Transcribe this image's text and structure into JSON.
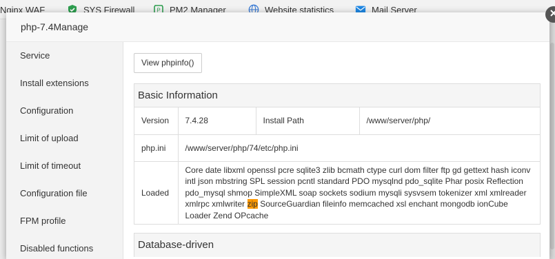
{
  "background_bar": {
    "items": [
      {
        "label": "Nginx WAF",
        "icon": "shield-icon"
      },
      {
        "label": "SYS Firewall",
        "icon": "shield-icon"
      },
      {
        "label": "PM2 Manager",
        "icon": "pm2-icon"
      },
      {
        "label": "Website statistics",
        "icon": "globe-icon"
      },
      {
        "label": "Mail Server",
        "icon": "mail-icon"
      }
    ]
  },
  "modal": {
    "title": "php-7.4Manage",
    "sidebar": [
      {
        "label": "Service"
      },
      {
        "label": "Install extensions"
      },
      {
        "label": "Configuration"
      },
      {
        "label": "Limit of upload"
      },
      {
        "label": "Limit of timeout"
      },
      {
        "label": "Configuration file"
      },
      {
        "label": "FPM profile"
      },
      {
        "label": "Disabled functions"
      }
    ],
    "view_phpinfo_label": "View phpinfo()",
    "basic_info": {
      "title": "Basic Information",
      "version_label": "Version",
      "version_value": "7.4.28",
      "install_path_label": "Install Path",
      "install_path_value": "/www/server/php/",
      "phpini_label": "php.ini",
      "phpini_value": "/www/server/php/74/etc/php.ini",
      "loaded_label": "Loaded",
      "loaded_before": "Core date libxml openssl pcre sqlite3 zlib bcmath ctype curl dom filter ftp gd gettext hash iconv intl json mbstring SPL session pcntl standard PDO mysqlnd pdo_sqlite Phar posix Reflection pdo_mysql shmop SimpleXML soap sockets sodium mysqli sysvsem tokenizer xml xmlreader xmlrpc xmlwriter",
      "loaded_highlight": "zip",
      "loaded_after": "SourceGuardian fileinfo memcached xsl enchant mongodb ionCube Loader Zend OPcache"
    },
    "database_driven": {
      "title": "Database-driven"
    }
  },
  "colors": {
    "highlight": "#ff9900",
    "close_button": "#555555"
  }
}
